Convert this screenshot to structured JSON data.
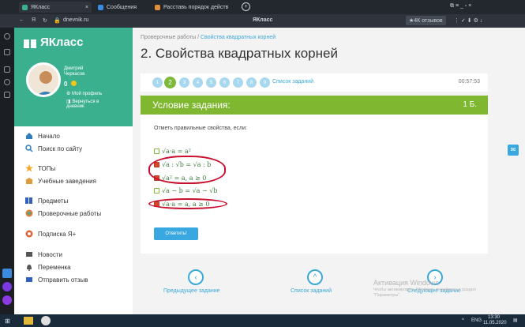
{
  "browser": {
    "tabs": [
      {
        "label": "ЯКласс",
        "active": true
      },
      {
        "label": "Сообщения"
      },
      {
        "label": "Расставь порядок действ"
      }
    ],
    "address": "dnevnik.ru",
    "site_title": "ЯКласс",
    "reviews_badge": "★4К отзывов"
  },
  "taskbar": {
    "lang": "ENG",
    "time": "13:30",
    "date": "11.05.2020"
  },
  "sidebar": {
    "logo": "ЯКласс",
    "user_name": "Дмитрий",
    "user_surname": "Черкасов",
    "score": "0",
    "my_profile": "Мой профиль",
    "back_to_diary": "Вернуться в дневник",
    "nav": [
      {
        "label": "Начало",
        "icon": "home-icon"
      },
      {
        "label": "Поиск по сайту",
        "icon": "search-icon"
      },
      {
        "label": "ТОПы",
        "icon": "star-icon"
      },
      {
        "label": "Учебные заведения",
        "icon": "school-icon"
      },
      {
        "label": "Предметы",
        "icon": "books-icon"
      },
      {
        "label": "Проверочные работы",
        "icon": "tests-icon"
      },
      {
        "label": "Подписка Я+",
        "icon": "subscription-icon"
      },
      {
        "label": "Новости",
        "icon": "news-icon"
      },
      {
        "label": "Переменка",
        "icon": "bell-icon"
      },
      {
        "label": "Отправить отзыв",
        "icon": "feedback-icon"
      }
    ]
  },
  "main": {
    "breadcrumb_parent": "Проверочные работы",
    "breadcrumb_current": "Свойства квадратных корней",
    "title": "2. Свойства квадратных корней",
    "steps": [
      "1",
      "2",
      "3",
      "4",
      "5",
      "6",
      "7",
      "8",
      "9"
    ],
    "current_step": 2,
    "task_list_link": "Список заданий",
    "timer": "00:57:53",
    "card_title": "Условие задания:",
    "points": "1 Б.",
    "question": "Отметь правильные свойства, если:",
    "options": [
      {
        "text": "√a·a = a²",
        "checked": false
      },
      {
        "text": "√a : √b = √a : b",
        "checked": true
      },
      {
        "text": "√a² = a, a ≥ 0",
        "checked": true
      },
      {
        "text": "√a − b = √a − √b",
        "checked": false
      },
      {
        "text": "√a·a = a, a ≥ 0",
        "checked": true
      }
    ],
    "submit_label": "Ответить!",
    "prev_label": "Предыдущее задание",
    "list_label": "Список заданий",
    "next_label": "Следующее задание",
    "activation_title": "Активация Windows",
    "activation_text": "Чтобы активировать Windows, перейдите в раздел \"Параметры\"."
  },
  "colors": {
    "green": "#7fb730",
    "teal": "#3ab08f",
    "blue": "#3aa8e0",
    "annotation": "#c8102e"
  }
}
